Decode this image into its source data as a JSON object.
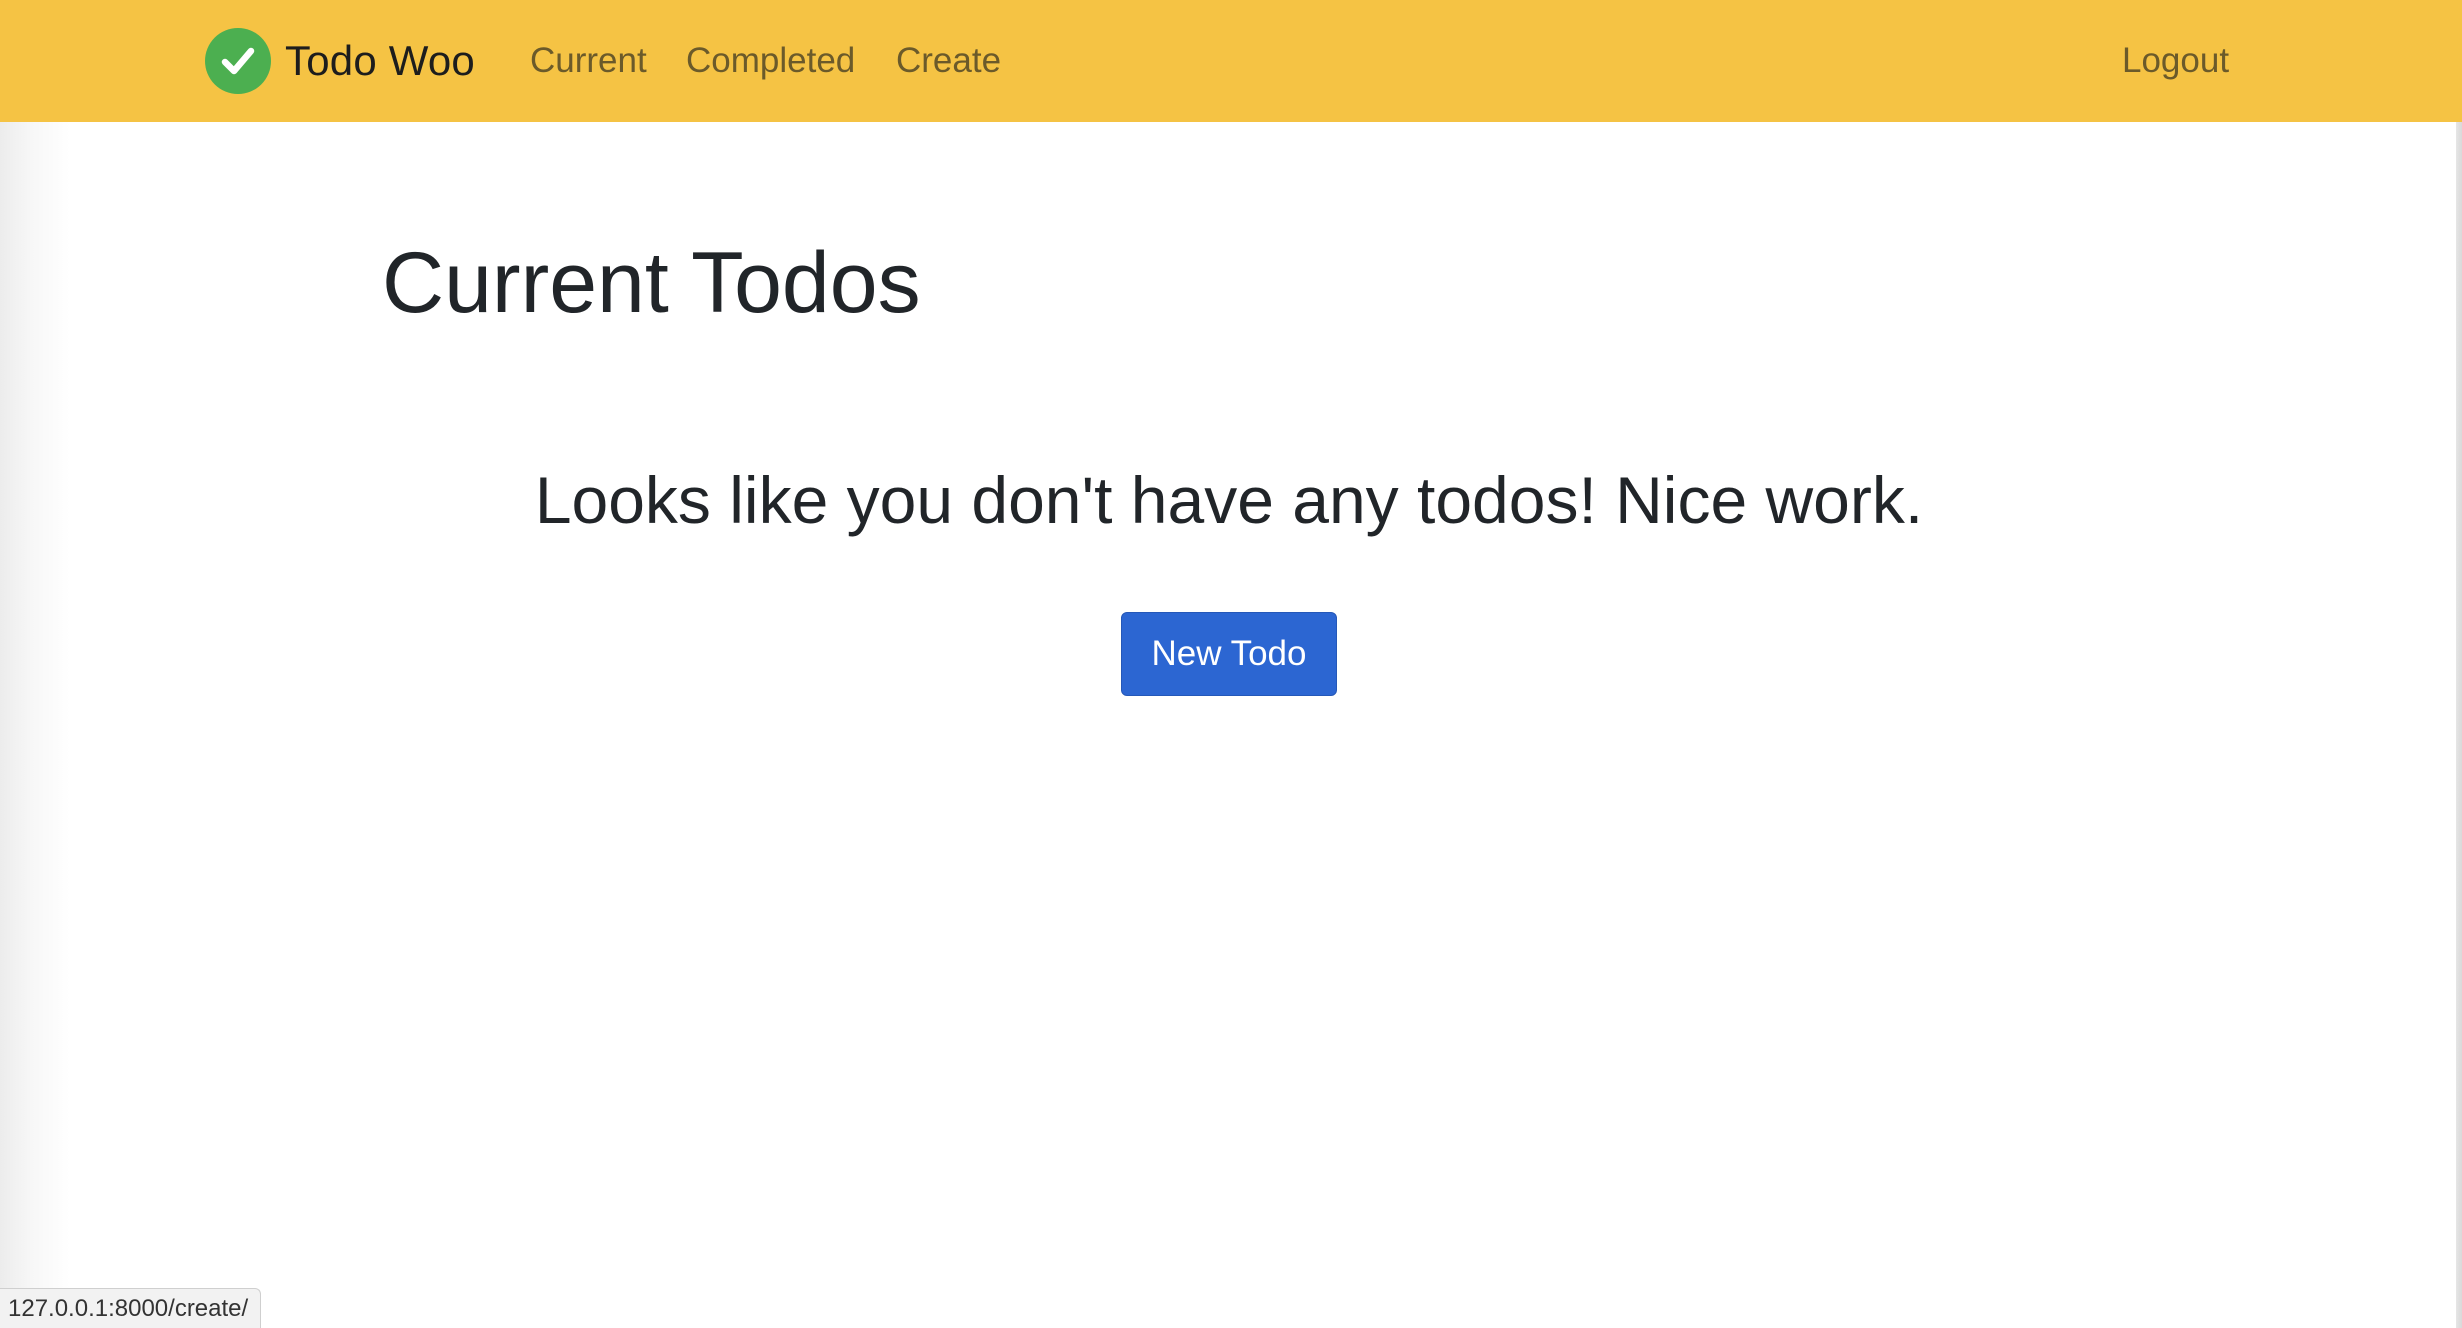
{
  "navbar": {
    "brand": "Todo Woo",
    "links": {
      "current": "Current",
      "completed": "Completed",
      "create": "Create",
      "logout": "Logout"
    },
    "background_color": "#f5c344",
    "logo_icon": "check-circle-icon",
    "logo_color": "#4caf50"
  },
  "main": {
    "title": "Current Todos",
    "empty_message": "Looks like you don't have any todos! Nice work.",
    "new_button": "New Todo",
    "button_color": "#2c66d2"
  },
  "status_bar": {
    "url": "127.0.0.1:8000/create/"
  }
}
